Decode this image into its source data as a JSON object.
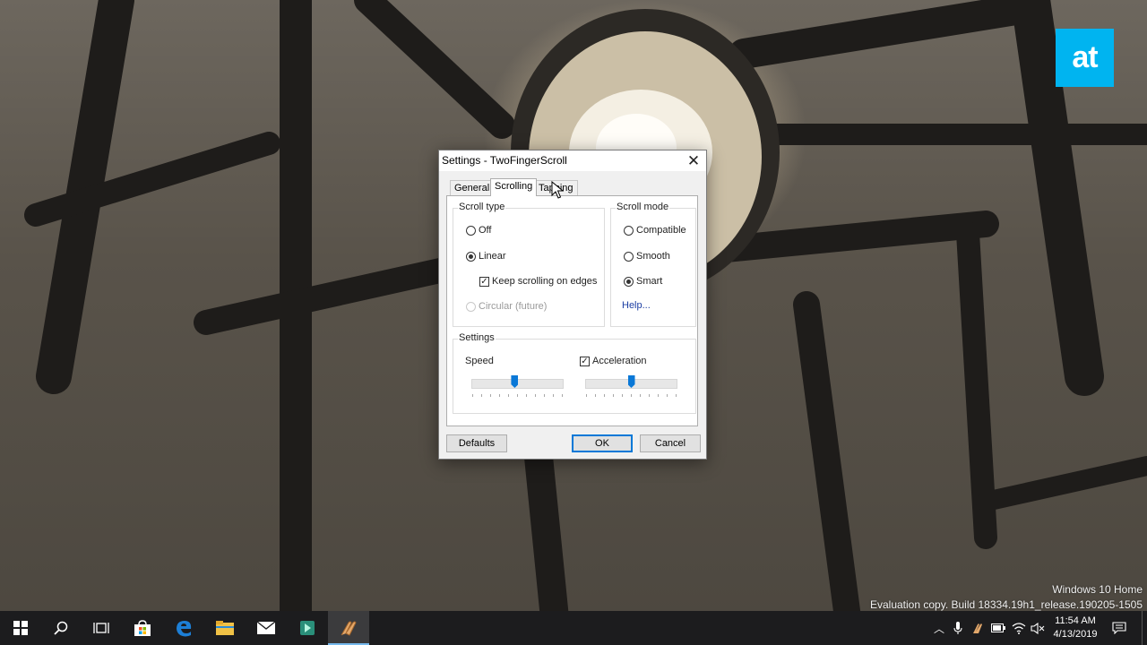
{
  "logo": {
    "text": "at"
  },
  "watermark": {
    "line1": "Windows 10 Home",
    "line2": "Evaluation copy. Build 18334.19h1_release.190205-1505"
  },
  "dialog": {
    "title": "Settings - TwoFingerScroll",
    "close_glyph": "✕",
    "tabs": [
      {
        "label": "General",
        "active": false
      },
      {
        "label": "Scrolling",
        "active": true
      },
      {
        "label": "Tapping",
        "active": false
      }
    ],
    "scroll_type": {
      "label": "Scroll type",
      "off": "Off",
      "linear": "Linear",
      "keep_scrolling": "Keep scrolling on edges",
      "circular": "Circular (future)",
      "selected": "Linear",
      "keep_scrolling_checked": true
    },
    "scroll_mode": {
      "label": "Scroll mode",
      "compatible": "Compatible",
      "smooth": "Smooth",
      "smart": "Smart",
      "selected": "Smart",
      "help_link": "Help..."
    },
    "settings": {
      "label": "Settings",
      "speed_label": "Speed",
      "speed_value": 0.47,
      "acceleration_label": "Acceleration",
      "acceleration_checked": true,
      "acceleration_value": 0.5
    },
    "buttons": {
      "defaults": "Defaults",
      "ok": "OK",
      "cancel": "Cancel"
    }
  },
  "taskbar": {
    "apps": [
      "start-icon",
      "search-icon",
      "task-view-icon",
      "store-icon",
      "edge-icon",
      "file-explorer-icon",
      "mail-icon",
      "filmora-icon",
      "twofingerscroll-icon"
    ],
    "clock": {
      "time": "11:54 AM",
      "date": "4/13/2019"
    }
  },
  "colors": {
    "accent": "#0078d7",
    "logo_bg": "#00b4f0",
    "taskbar_bg": "#1c1c1e"
  }
}
